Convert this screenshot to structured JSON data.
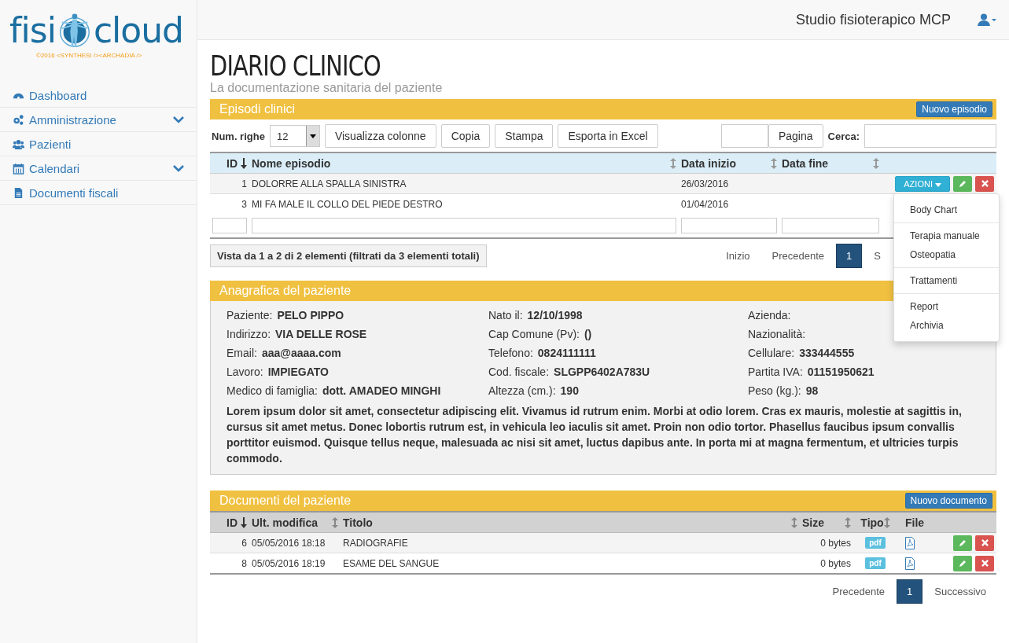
{
  "logo": {
    "left": "fisi",
    "right": "cloud",
    "credit": "©2016 <SYNTHESI /><ARCHADIA />"
  },
  "sidebar": {
    "items": [
      {
        "label": "Dashboard",
        "expandable": false
      },
      {
        "label": "Amministrazione",
        "expandable": true
      },
      {
        "label": "Pazienti",
        "expandable": false
      },
      {
        "label": "Calendari",
        "expandable": true
      },
      {
        "label": "Documenti fiscali",
        "expandable": false
      }
    ]
  },
  "topbar": {
    "studio": "Studio fisioterapico MCP"
  },
  "page": {
    "title": "DIARIO CLINICO",
    "subtitle": "La documentazione sanitaria del paziente"
  },
  "episodes": {
    "title": "Episodi clinici",
    "new_button": "Nuovo episodio",
    "rows_label": "Num. righe",
    "rows_value": "12",
    "tools": [
      "Visualizza colonne",
      "Copia",
      "Stampa",
      "Esporta in Excel"
    ],
    "page_button": "Pagina",
    "search_label": "Cerca:",
    "columns": [
      {
        "label": "ID"
      },
      {
        "label": "Nome episodio"
      },
      {
        "label": "Data inizio"
      },
      {
        "label": "Data fine"
      }
    ],
    "rows": [
      {
        "id": "1",
        "name": "DOLORRE ALLA SPALLA SINISTRA",
        "start": "26/03/2016",
        "menu_open": true
      },
      {
        "id": "3",
        "name": "MI FA MALE IL COLLO DEL PIEDE DESTRO",
        "start": "01/04/2016",
        "menu_open": false
      }
    ],
    "actions_button": "AZIONI",
    "info": "Vista da 1 a 2 di 2 elementi (filtrati da 3 elementi totali)",
    "pager": [
      {
        "label": "Inizio",
        "selected": false
      },
      {
        "label": "Precedente",
        "selected": false
      },
      {
        "label": "1",
        "selected": true
      },
      {
        "label": "S",
        "selected": false
      }
    ],
    "menu": [
      [
        "Body Chart"
      ],
      [
        "Terapia manuale",
        "Osteopatia"
      ],
      [
        "Trattamenti"
      ],
      [
        "Report",
        "Archivia"
      ]
    ]
  },
  "patient": {
    "title": "Anagrafica del paziente",
    "fields": [
      [
        {
          "label": "Paziente:",
          "value": "PELO PIPPO"
        },
        {
          "label": "Nato il:",
          "value": "12/10/1998"
        },
        {
          "label": "Azienda:"
        }
      ],
      [
        {
          "label": "Indirizzo:",
          "value": "VIA DELLE ROSE"
        },
        {
          "label": "Cap Comune (Pv):",
          "value": "()"
        },
        {
          "label": "Nazionalità:"
        }
      ],
      [
        {
          "label": "Email:",
          "value": "aaa@aaaa.com"
        },
        {
          "label": "Telefono:",
          "value": "0824111111"
        },
        {
          "label": "Cellulare:",
          "value": "333444555"
        }
      ],
      [
        {
          "label": "Lavoro:",
          "value": "IMPIEGATO"
        },
        {
          "label": "Cod. fiscale:",
          "value": "SLGPP6402A783U"
        },
        {
          "label": "Partita IVA:",
          "value": "01151950621"
        }
      ],
      [
        {
          "label": "Medico di famiglia:",
          "value": "dott. AMADEO MINGHI"
        },
        {
          "label": "Altezza (cm.):",
          "value": "190"
        },
        {
          "label": "Peso (kg.):",
          "value": "98"
        }
      ]
    ],
    "notes": "Lorem ipsum dolor sit amet, consectetur adipiscing elit. Vivamus id rutrum enim. Morbi at odio lorem. Cras ex mauris, molestie at sagittis in, cursus sit amet metus. Donec lobortis rutrum est, in vehicula leo iaculis sit amet. Proin non odio tortor. Phasellus faucibus ipsum convallis porttitor euismod. Quisque tellus neque, malesuada ac nisi sit amet, luctus dapibus ante. In porta mi at magna fermentum, et ultricies turpis commodo."
  },
  "documents": {
    "title": "Documenti del paziente",
    "new_button": "Nuovo documento",
    "columns": [
      {
        "label": "ID"
      },
      {
        "label": "Ult. modifica"
      },
      {
        "label": "Titolo"
      },
      {
        "label": "Size"
      },
      {
        "label": "Tipo"
      },
      {
        "label": "File"
      }
    ],
    "rows": [
      {
        "id": "6",
        "modified": "05/05/2016 18:18",
        "title": "RADIOGRAFIE",
        "size": "0 bytes",
        "type": "pdf"
      },
      {
        "id": "8",
        "modified": "05/05/2016 18:19",
        "title": "ESAME DEL SANGUE",
        "size": "0 bytes",
        "type": "pdf"
      }
    ],
    "pager": [
      {
        "label": "Precedente",
        "selected": false
      },
      {
        "label": "1",
        "selected": true
      },
      {
        "label": "Successivo",
        "selected": false
      }
    ]
  }
}
